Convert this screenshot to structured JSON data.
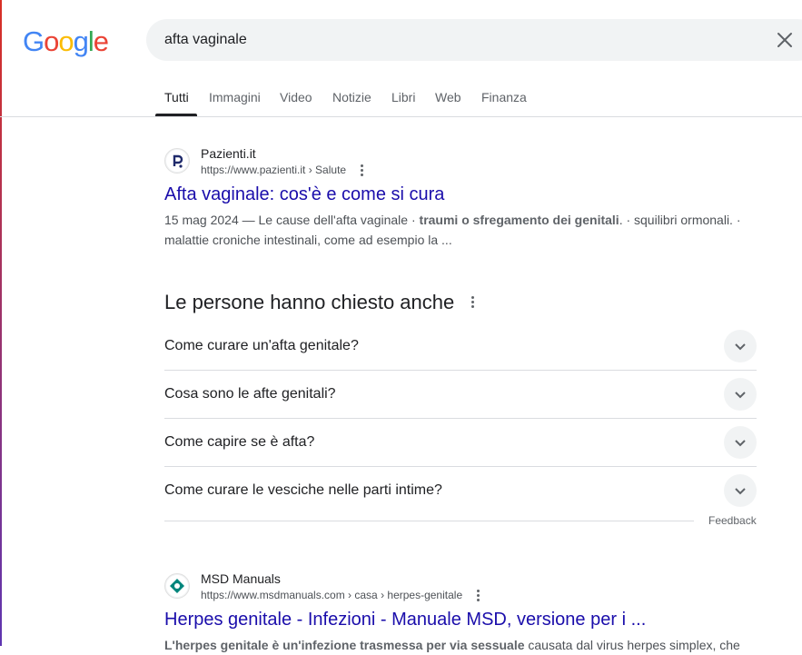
{
  "search": {
    "query": "afta vaginale",
    "logo_letters": [
      "G",
      "o",
      "o",
      "g",
      "l",
      "e"
    ],
    "logo_colors": [
      "#4285F4",
      "#EA4335",
      "#FBBC05",
      "#4285F4",
      "#34A853",
      "#EA4335"
    ]
  },
  "tabs": [
    {
      "label": "Tutti",
      "active": true
    },
    {
      "label": "Immagini"
    },
    {
      "label": "Video"
    },
    {
      "label": "Notizie"
    },
    {
      "label": "Libri"
    },
    {
      "label": "Web"
    },
    {
      "label": "Finanza"
    }
  ],
  "results": [
    {
      "site": "Pazienti.it",
      "url": "https://www.pazienti.it › Salute",
      "title": "Afta vaginale: cos'è e come si cura",
      "date": "15 mag 2024",
      "snippet_pre": " — Le cause dell'afta vaginale · ",
      "snippet_bold": "traumi o sfregamento dei genitali",
      "snippet_post": ". · squilibri ormonali. · malattie croniche intestinali, come ad esempio la ..."
    },
    {
      "site": "MSD Manuals",
      "url": "https://www.msdmanuals.com › casa › herpes-genitale",
      "title": "Herpes genitale - Infezioni - Manuale MSD, versione per i ...",
      "snippet_bold": "L'herpes genitale è un'infezione trasmessa per via sessuale",
      "snippet_post": " causata dal virus herpes simplex, che"
    }
  ],
  "paa": {
    "title": "Le persone hanno chiesto anche",
    "questions": [
      "Come curare un'afta genitale?",
      "Cosa sono le afte genitali?",
      "Come capire se è afta?",
      "Come curare le vesciche nelle parti intime?"
    ],
    "feedback": "Feedback"
  }
}
